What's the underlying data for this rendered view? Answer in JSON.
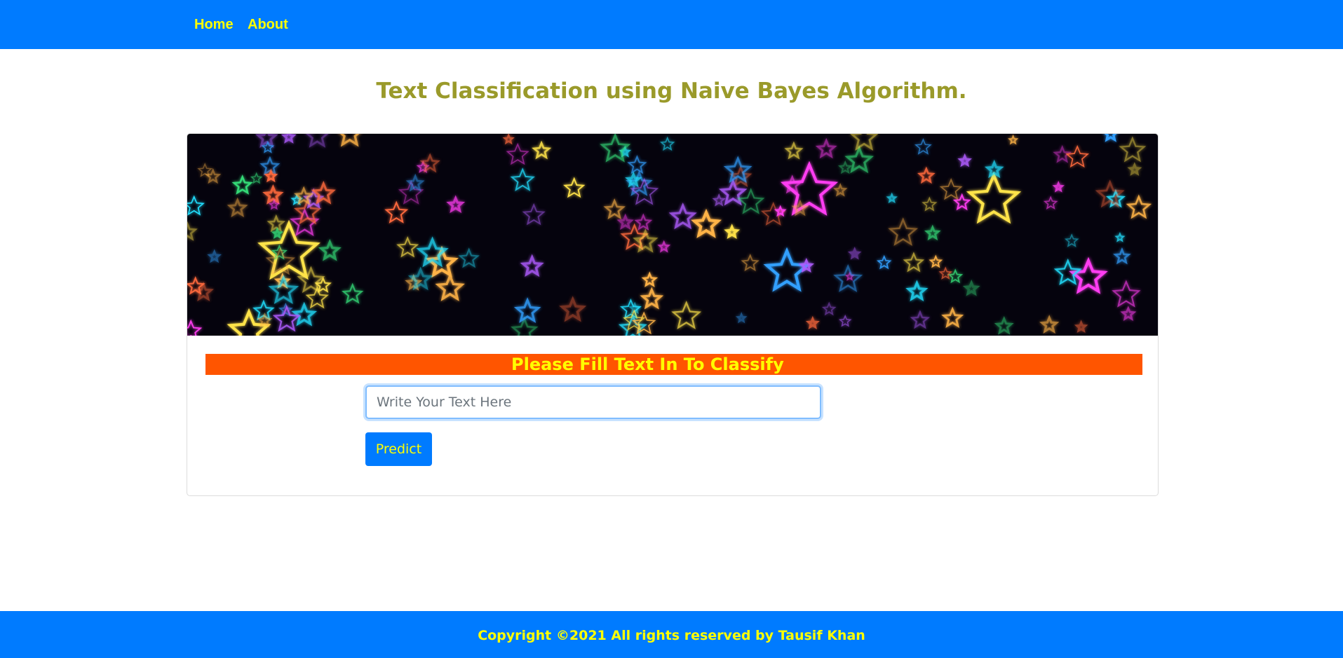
{
  "navbar": {
    "links": [
      {
        "label": "Home"
      },
      {
        "label": "About"
      }
    ]
  },
  "page": {
    "title": "Text Classification using Naive Bayes Algorithm."
  },
  "banner": {
    "image": "neon-stars-background",
    "star_colors": [
      "#ffe34a",
      "#ff3df2",
      "#33a0ff",
      "#20e0ff",
      "#36e07a",
      "#ff6a3d",
      "#b05cff",
      "#ffb347"
    ]
  },
  "form": {
    "heading": "Please Fill Text In To Classify",
    "input_placeholder": "Write Your Text Here",
    "input_value": "",
    "predict_label": "Predict"
  },
  "footer": {
    "copyright": "Copyright ©2021 All rights reserved by Tausif Khan"
  },
  "colors": {
    "navbar_bg": "#007bff",
    "link_text": "#ffff00",
    "title_text": "#9a9a2a",
    "heading_bg": "#ff5500",
    "button_bg": "#007bff"
  }
}
